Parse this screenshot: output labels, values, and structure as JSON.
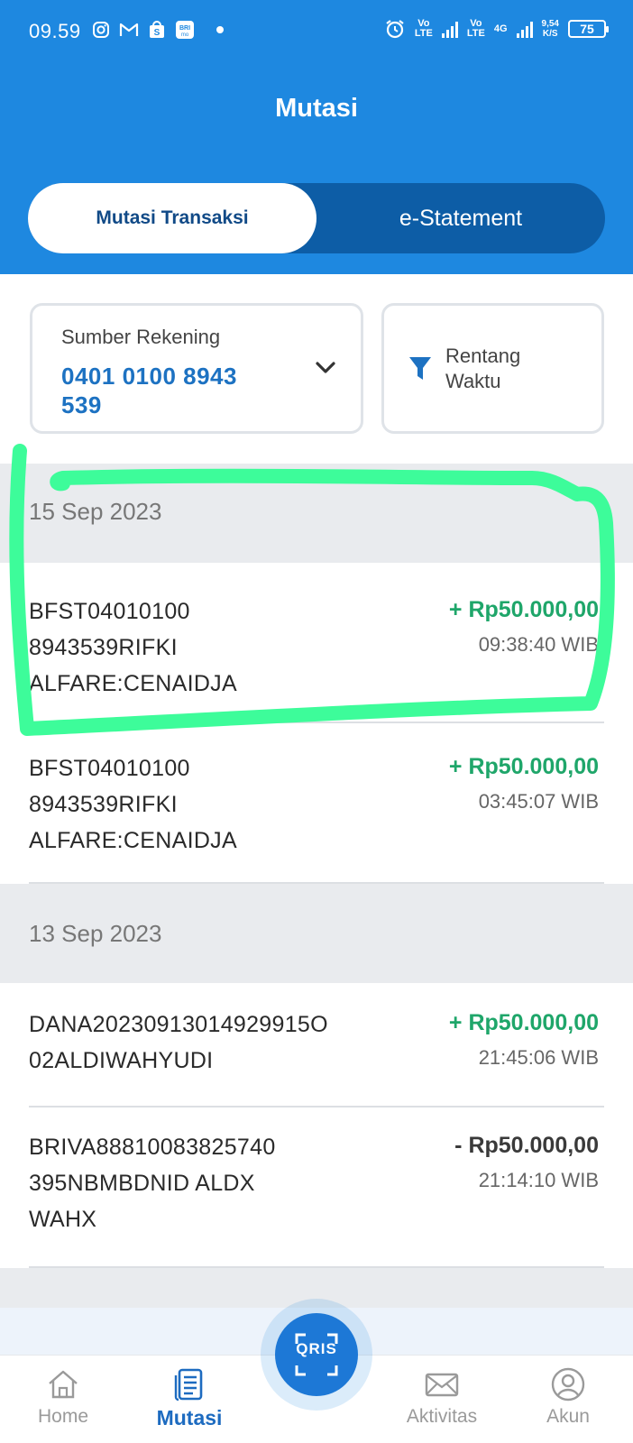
{
  "status_bar": {
    "time": "09.59",
    "net1": "Vo\nLTE",
    "net2": "Vo\nLTE",
    "net3": "4G",
    "speed_value": "9,54",
    "speed_unit": "K/S",
    "battery": "75"
  },
  "header": {
    "title": "Mutasi",
    "tabs": [
      {
        "label": "Mutasi Transaksi",
        "active": true
      },
      {
        "label": "e-Statement",
        "active": false
      }
    ]
  },
  "filters": {
    "source_label": "Sumber Rekening",
    "source_value": "0401 0100 8943 539",
    "range_label": "Rentang Waktu"
  },
  "groups": [
    {
      "date": "15 Sep 2023",
      "transactions": [
        {
          "desc": [
            "BFST04010100",
            "8943539RIFKI",
            "ALFARE:CENAIDJA"
          ],
          "amount": "+ Rp50.000,00",
          "type": "credit",
          "time": "09:38:40 WIB"
        },
        {
          "desc": [
            "BFST04010100",
            "8943539RIFKI",
            "ALFARE:CENAIDJA"
          ],
          "amount": "+ Rp50.000,00",
          "type": "credit",
          "time": "03:45:07 WIB"
        }
      ]
    },
    {
      "date": "13 Sep 2023",
      "transactions": [
        {
          "desc": [
            "DANA20230913014929915O",
            "02ALDIWAHYUDI"
          ],
          "amount": "+ Rp50.000,00",
          "type": "credit",
          "time": "21:45:06 WIB"
        },
        {
          "desc": [
            "BRIVA88810083825740",
            "395NBMBDNID ALDX",
            "WAHX"
          ],
          "amount": "- Rp50.000,00",
          "type": "debit",
          "time": "21:14:10 WIB"
        }
      ]
    }
  ],
  "bottom_nav": {
    "items": [
      {
        "label": "Home",
        "icon": "home-icon",
        "active": false
      },
      {
        "label": "Mutasi",
        "icon": "mutasi-icon",
        "active": true
      },
      {
        "label": "Aktivitas",
        "icon": "mail-icon",
        "active": false
      },
      {
        "label": "Akun",
        "icon": "user-icon",
        "active": false
      }
    ],
    "qris_label": "QRIS"
  },
  "colors": {
    "header_blue": "#1e88e0",
    "tab_dark": "#0d5da6",
    "credit_green": "#1fa66a",
    "highlight_green": "#3dfc9a"
  }
}
